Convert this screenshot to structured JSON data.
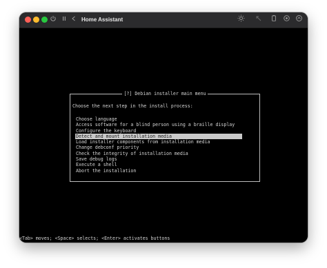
{
  "window": {
    "title": "Home Assistant"
  },
  "toolbar": {
    "icons": [
      "power-icon",
      "pause-icon",
      "back-icon",
      "brightness-icon",
      "expand-icon",
      "clipboard-icon",
      "capture-icon",
      "share-icon"
    ]
  },
  "installer": {
    "dialog_title": "[?] Debian installer main menu",
    "prompt": "Choose the next step in the install process:",
    "menu_items": [
      "Choose language",
      "Access software for a blind person using a braille display",
      "Configure the keyboard",
      "Detect and mount installation media",
      "Load installer components from installation media",
      "Change debconf priority",
      "Check the integrity of installation media",
      "Save debug logs",
      "Execute a shell",
      "Abort the installation"
    ],
    "selected_index": 3,
    "status_line": "<Tab> moves; <Space> selects; <Enter> activates buttons"
  },
  "colors": {
    "background": "#000000",
    "text": "#c9c9c9",
    "highlight": "#c9c9c9",
    "close": "#ff5f57",
    "minimize": "#febc2e",
    "zoom": "#28c840"
  }
}
